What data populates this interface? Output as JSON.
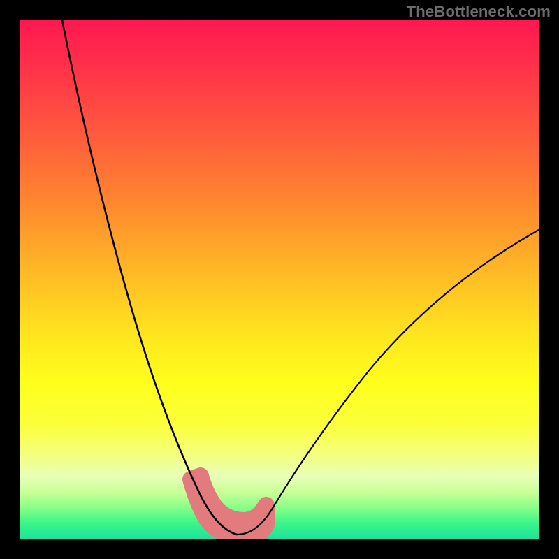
{
  "attribution": "TheBottleneck.com",
  "chart_data": {
    "type": "line",
    "title": "",
    "xlabel": "",
    "ylabel": "",
    "ylim": [
      0,
      100
    ],
    "x": [
      0,
      5,
      10,
      15,
      20,
      25,
      30,
      33,
      36,
      39,
      42,
      45,
      50,
      55,
      60,
      65,
      70,
      75,
      80,
      85,
      90,
      95,
      100
    ],
    "values": [
      100,
      82,
      66,
      52,
      40,
      28,
      16,
      8,
      3,
      1,
      0,
      0,
      2,
      6,
      12,
      19,
      26,
      32,
      38,
      44,
      49,
      54,
      58
    ],
    "series": [
      {
        "name": "bottleneck-curve",
        "color": "#000000",
        "values": [
          100,
          82,
          66,
          52,
          40,
          28,
          16,
          8,
          3,
          1,
          0,
          0,
          2,
          6,
          12,
          19,
          26,
          32,
          38,
          44,
          49,
          54,
          58
        ]
      },
      {
        "name": "optimal-band",
        "color": "#e27b7e",
        "x": [
          33,
          36,
          39,
          42,
          45,
          48
        ],
        "values": [
          8,
          3,
          1,
          0,
          0,
          2
        ]
      }
    ],
    "gradient_stops": [
      {
        "pct": 0,
        "color": "#ff1850"
      },
      {
        "pct": 60,
        "color": "#ffe31f"
      },
      {
        "pct": 100,
        "color": "#1be49e"
      }
    ]
  }
}
